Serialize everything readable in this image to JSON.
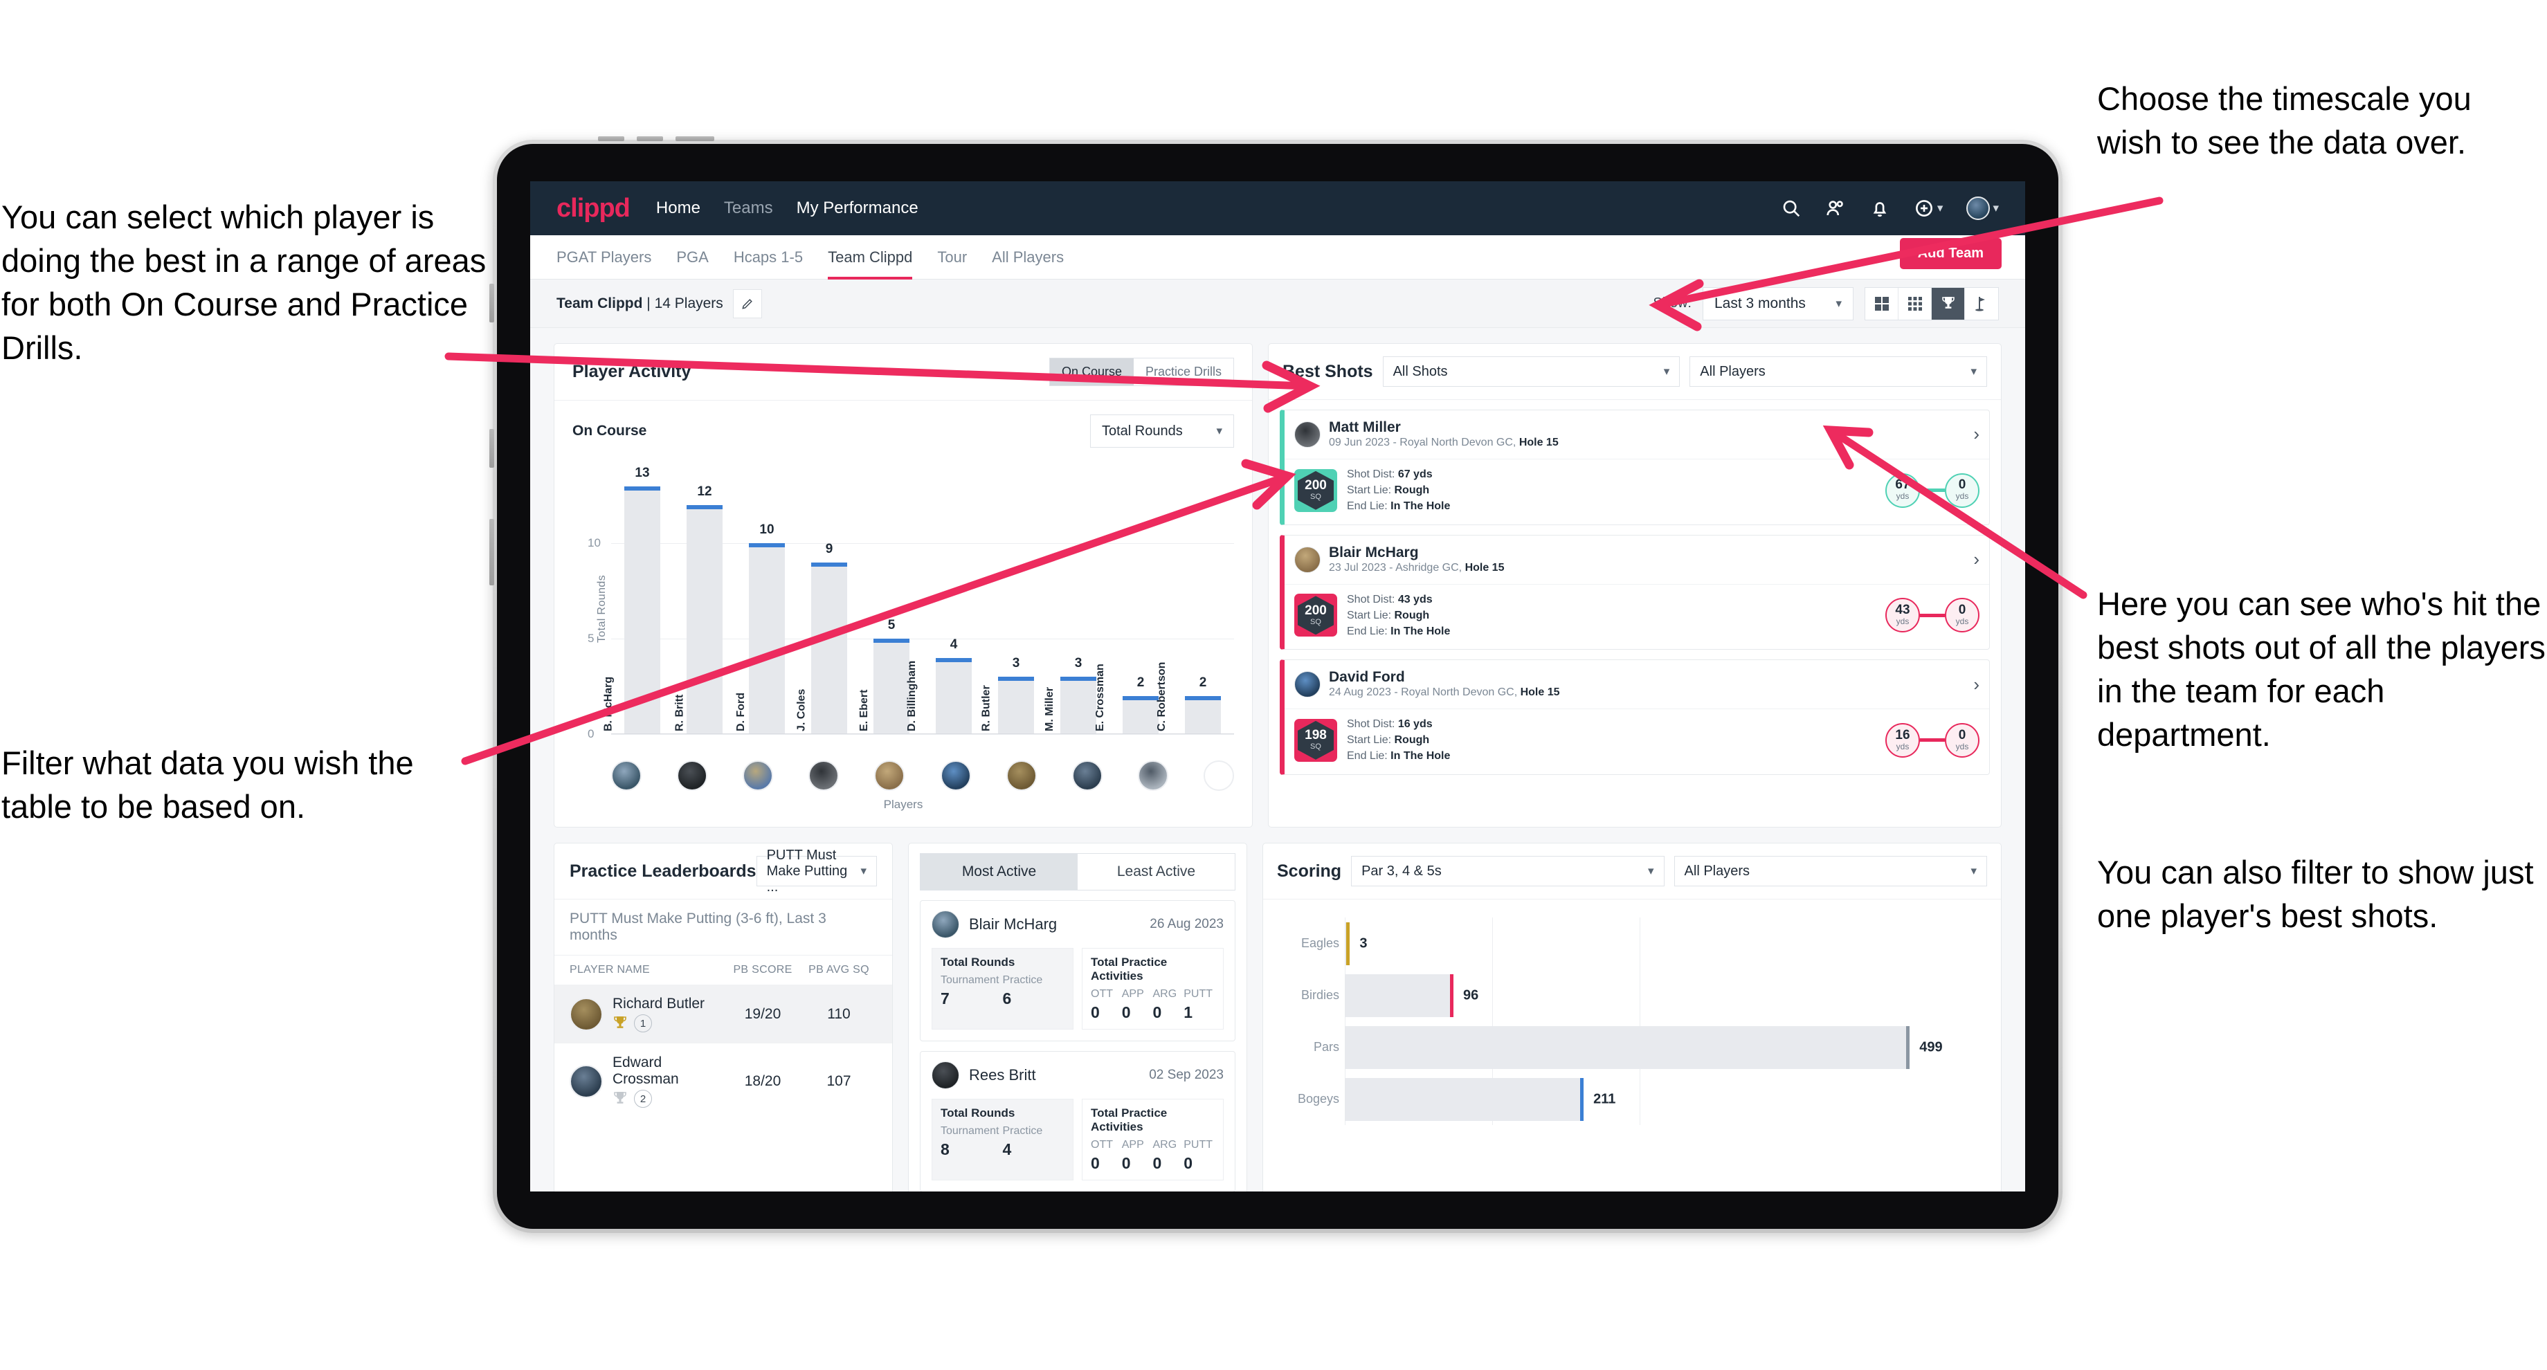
{
  "annotations": {
    "top_left": "You can select which player is doing the best in a range of areas for both On Course and Practice Drills.",
    "bottom_left": "Filter what data you wish the table to be based on.",
    "top_right": "Choose the timescale you wish to see the data over.",
    "right_middle": "Here you can see who's hit the best shots out of all the players in the team for each department.",
    "right_bottom": "You can also filter to show just one player's best shots."
  },
  "appbar": {
    "logo": "clippd",
    "nav": [
      {
        "label": "Home",
        "active": true
      },
      {
        "label": "Teams",
        "active": false
      },
      {
        "label": "My Performance",
        "active": true
      }
    ],
    "icons": [
      "search-icon",
      "people-icon",
      "bell-icon",
      "plus-circle-icon",
      "avatar"
    ]
  },
  "tabs": {
    "items": [
      {
        "label": "PGAT Players",
        "active": false
      },
      {
        "label": "PGA",
        "active": false
      },
      {
        "label": "Hcaps 1-5",
        "active": false
      },
      {
        "label": "Team Clippd",
        "active": true
      },
      {
        "label": "Tour",
        "active": false
      },
      {
        "label": "All Players",
        "active": false
      }
    ],
    "add_team_button": "Add Team"
  },
  "toolbar": {
    "team_name": "Team Clippd",
    "team_players": " | 14 Players",
    "show_label": "Show:",
    "timescale_value": "Last 3 months",
    "view_buttons": [
      "grid-2x2-icon",
      "grid-3x3-icon",
      "trophy-icon",
      "golf-flag-icon"
    ],
    "active_view": 2
  },
  "player_activity": {
    "title": "Player Activity",
    "segmented": [
      {
        "label": "On Course",
        "active": true
      },
      {
        "label": "Practice Drills",
        "active": false
      }
    ],
    "sub_label": "On Course",
    "metric_select": "Total Rounds"
  },
  "chart_data": {
    "type": "bar",
    "title": "Player Activity — On Course",
    "xlabel": "Players",
    "ylabel": "Total Rounds",
    "ylim": [
      0,
      14
    ],
    "yticks": [
      0,
      5,
      10
    ],
    "grid": true,
    "categories": [
      "B. McHarg",
      "R. Britt",
      "D. Ford",
      "J. Coles",
      "E. Ebert",
      "D. Billingham",
      "R. Butler",
      "M. Miller",
      "E. Crossman",
      "C. Robertson"
    ],
    "values": [
      13,
      12,
      10,
      9,
      5,
      4,
      3,
      3,
      2,
      2
    ],
    "bar_color": "#e6e8ec",
    "cap_color": "#3b7fd4"
  },
  "best_shots": {
    "title": "Best Shots",
    "shot_filter": "All Shots",
    "player_filter": "All Players",
    "cards": [
      {
        "name": "Matt Miller",
        "meta_date": "09 Jun 2023 - Royal North Devon GC, ",
        "meta_hole": "Hole 15",
        "badge_value": "200",
        "badge_unit": "SQ",
        "accent": "#4fd1b4",
        "shot_dist_label": "Shot Dist: ",
        "shot_dist": "67 yds",
        "start_lie_label": "Start Lie: ",
        "start_lie": "Rough",
        "end_lie_label": "End Lie: ",
        "end_lie": "In The Hole",
        "from_value": "67",
        "from_unit": "yds",
        "to_value": "0",
        "to_unit": "yds"
      },
      {
        "name": "Blair McHarg",
        "meta_date": "23 Jul 2023 - Ashridge GC, ",
        "meta_hole": "Hole 15",
        "badge_value": "200",
        "badge_unit": "SQ",
        "accent": "#e8285c",
        "shot_dist_label": "Shot Dist: ",
        "shot_dist": "43 yds",
        "start_lie_label": "Start Lie: ",
        "start_lie": "Rough",
        "end_lie_label": "End Lie: ",
        "end_lie": "In The Hole",
        "from_value": "43",
        "from_unit": "yds",
        "to_value": "0",
        "to_unit": "yds"
      },
      {
        "name": "David Ford",
        "meta_date": "24 Aug 2023 - Royal North Devon GC, ",
        "meta_hole": "Hole 15",
        "badge_value": "198",
        "badge_unit": "SQ",
        "accent": "#e8285c",
        "shot_dist_label": "Shot Dist: ",
        "shot_dist": "16 yds",
        "start_lie_label": "Start Lie: ",
        "start_lie": "Rough",
        "end_lie_label": "End Lie: ",
        "end_lie": "In The Hole",
        "from_value": "16",
        "from_unit": "yds",
        "to_value": "0",
        "to_unit": "yds"
      }
    ]
  },
  "practice_leaderboards": {
    "title": "Practice Leaderboards",
    "drill_select": "PUTT Must Make Putting ...",
    "subtitle_bold": "PUTT Must Make Putting (3-6 ft),",
    "subtitle_light": " Last 3 months",
    "columns": [
      "PLAYER NAME",
      "PB SCORE",
      "PB AVG SQ"
    ],
    "rows": [
      {
        "name": "Richard Butler",
        "rank": "1",
        "trophy": "gold",
        "pb_score": "19/20",
        "pb_avg_sq": "110",
        "highlight": true
      },
      {
        "name": "Edward Crossman",
        "rank": "2",
        "trophy": "silver",
        "pb_score": "18/20",
        "pb_avg_sq": "107",
        "highlight": false
      }
    ]
  },
  "activity_panel": {
    "tabs": [
      {
        "label": "Most Active",
        "active": true
      },
      {
        "label": "Least Active",
        "active": false
      }
    ],
    "cards": [
      {
        "name": "Blair McHarg",
        "date": "26 Aug 2023",
        "rounds_title": "Total Rounds",
        "rounds_keys": [
          "Tournament",
          "Practice"
        ],
        "rounds_values": [
          "7",
          "6"
        ],
        "practice_title": "Total Practice Activities",
        "practice_keys": [
          "OTT",
          "APP",
          "ARG",
          "PUTT"
        ],
        "practice_values": [
          "0",
          "0",
          "0",
          "1"
        ]
      },
      {
        "name": "Rees Britt",
        "date": "02 Sep 2023",
        "rounds_title": "Total Rounds",
        "rounds_keys": [
          "Tournament",
          "Practice"
        ],
        "rounds_values": [
          "8",
          "4"
        ],
        "practice_title": "Total Practice Activities",
        "practice_keys": [
          "OTT",
          "APP",
          "ARG",
          "PUTT"
        ],
        "practice_values": [
          "0",
          "0",
          "0",
          "0"
        ]
      }
    ]
  },
  "scoring": {
    "title": "Scoring",
    "par_filter": "Par 3, 4 & 5s",
    "player_filter": "All Players",
    "chart": {
      "type": "bar",
      "orientation": "horizontal",
      "categories": [
        "Eagles",
        "Birdies",
        "Pars",
        "Bogeys"
      ],
      "values": [
        3,
        96,
        499,
        211
      ],
      "colors": [
        "#c9a227",
        "#e8285c",
        "#8b96a2",
        "#3b7fd4"
      ],
      "xlim": [
        0,
        560
      ],
      "grid": true
    }
  },
  "colors": {
    "brand_pink": "#e8285c",
    "header_navy": "#1b2a39",
    "blue": "#3b7fd4",
    "teal": "#4fd1b4"
  }
}
